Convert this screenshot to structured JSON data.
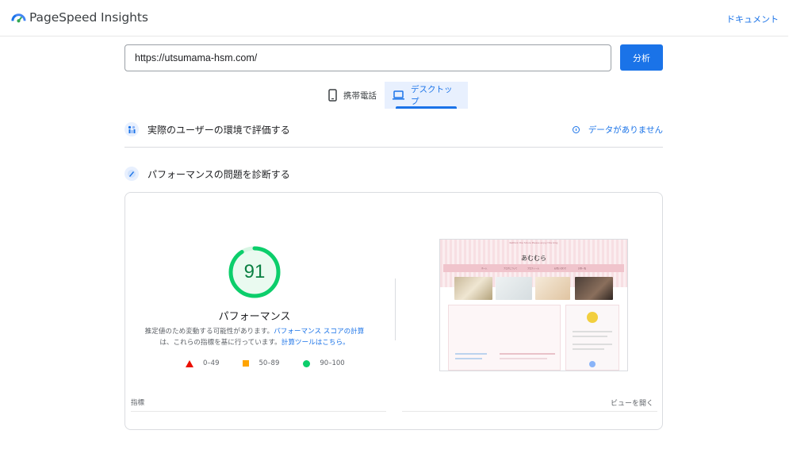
{
  "header": {
    "app_title": "PageSpeed Insights",
    "docs_link": "ドキュメント",
    "logo_icon": "pagespeed-logo-icon"
  },
  "search": {
    "url_value": "https://utsumama-hsm.com/",
    "analyze_label": "分析"
  },
  "device_tabs": [
    {
      "label": "携帯電話",
      "icon": "smartphone-icon",
      "selected": false
    },
    {
      "label": "デスクトップ",
      "icon": "laptop-icon",
      "selected": true
    }
  ],
  "field_data": {
    "title": "実際のユーザーの環境で評価する",
    "status": "データがありません",
    "icon": "users-icon",
    "status_icon": "info-icon"
  },
  "lab_data": {
    "title": "パフォーマンスの問題を診断する",
    "icon": "lighthouse-icon"
  },
  "performance": {
    "score": "91",
    "score_fraction": 0.91,
    "label": "パフォーマンス",
    "desc_text_1": "推定値のため変動する可能性があります。",
    "desc_link_1": "パフォーマンス スコアの計算",
    "desc_text_2": "は、これらの指標を基に行っています。",
    "desc_link_2": "計算ツールはこちら。",
    "legend": [
      {
        "range": "0–49",
        "color": "#eb0f00",
        "shape": "triangle"
      },
      {
        "range": "50–89",
        "color": "#ffa400",
        "shape": "square"
      },
      {
        "range": "90–100",
        "color": "#0cce6b",
        "shape": "circle"
      }
    ],
    "score_color": "#0cce6b"
  },
  "screenshot": {
    "site_title": "あむむら",
    "top_banner": "Rethink the future Please enjoy this blog",
    "nav_items": [
      "ホーム",
      "ブログについて",
      "プロフィール",
      "お問い合わせ",
      "記事一覧"
    ]
  },
  "metrics": {
    "label": "指標",
    "view_toggle": "ビューを開く"
  },
  "colors": {
    "accent": "#1a73e8",
    "good": "#0cce6b",
    "average": "#ffa400",
    "poor": "#eb0f00"
  }
}
